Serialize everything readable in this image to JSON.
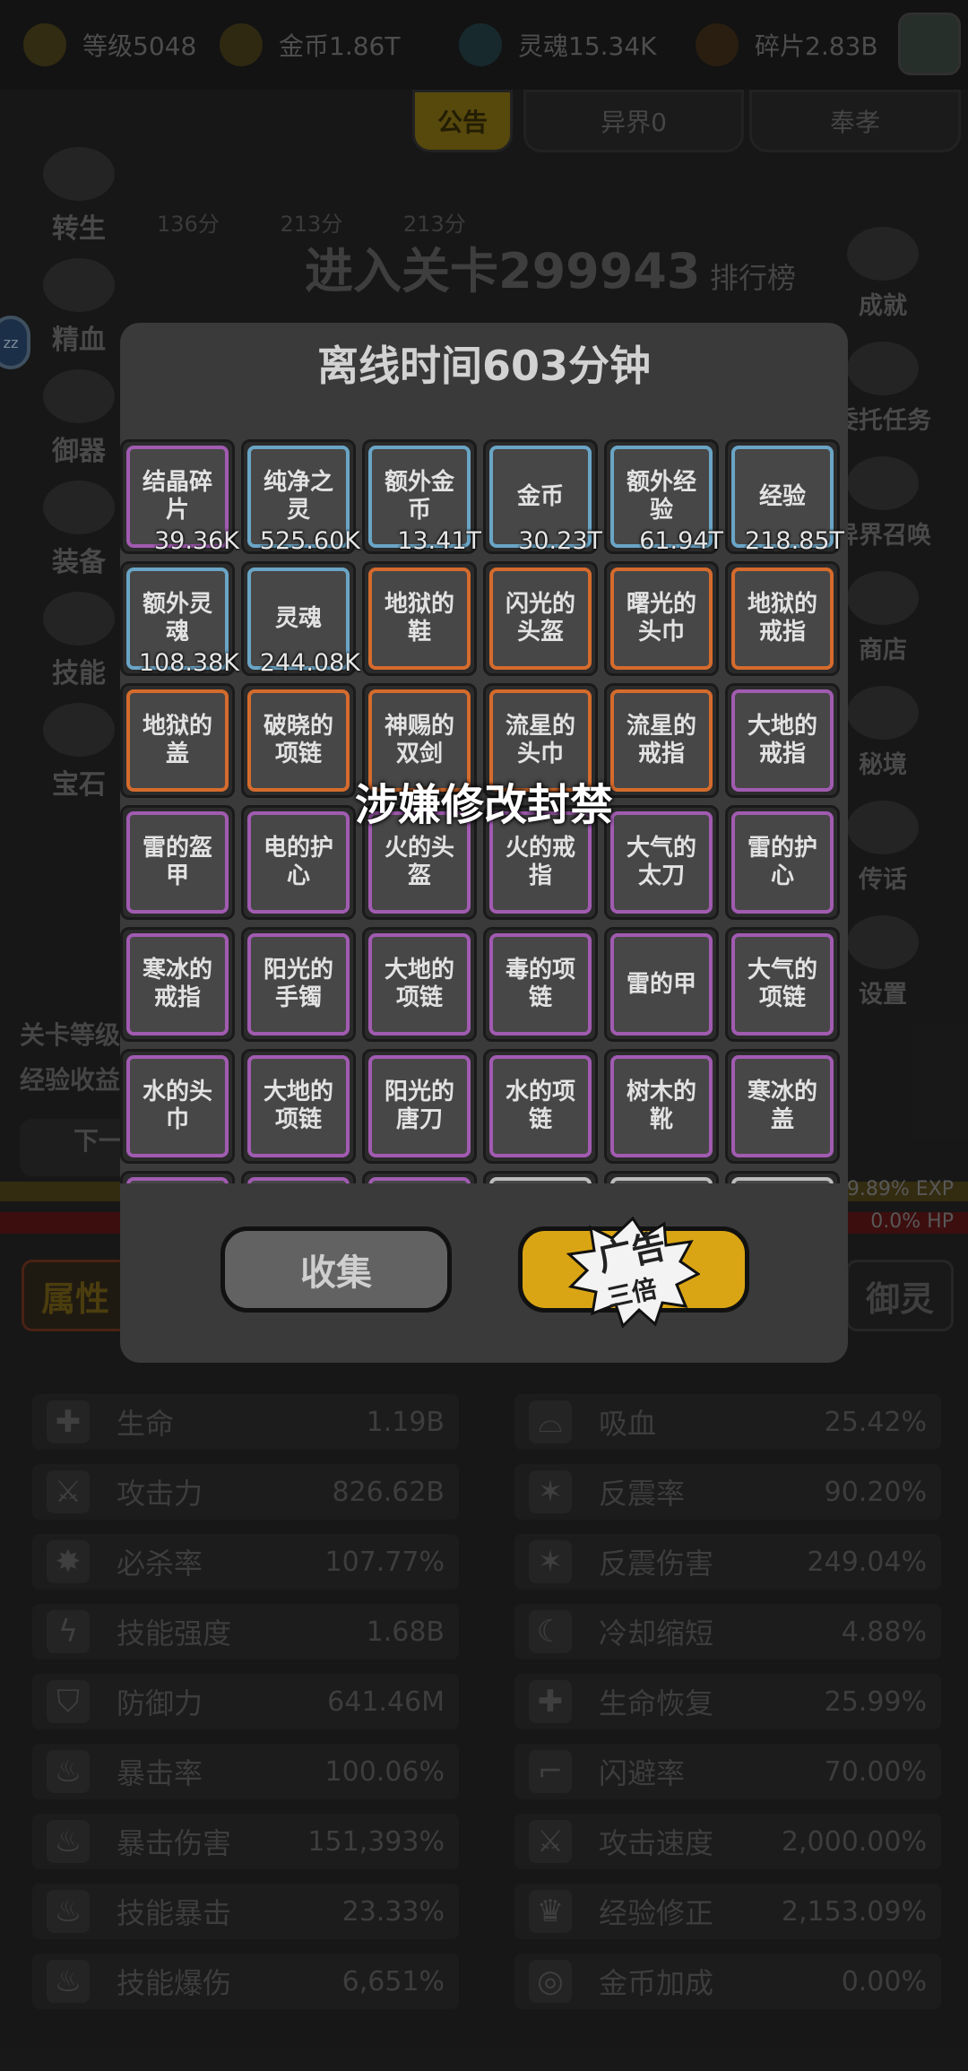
{
  "resources": [
    {
      "label": "等级5048",
      "icon": "crown-icon",
      "color": "#7a6a25"
    },
    {
      "label": "金币1.86T",
      "icon": "coin-icon",
      "color": "#6b5a20"
    },
    {
      "label": "灵魂15.34K",
      "icon": "soul-icon",
      "color": "#2d5560"
    },
    {
      "label": "碎片2.83B",
      "icon": "shard-icon",
      "color": "#5a4020"
    }
  ],
  "background": {
    "tabs": {
      "notice": "公告",
      "otherworld": "异界0",
      "offering": "奉孝"
    },
    "scores": [
      "136分",
      "213分",
      "213分"
    ],
    "stage_title": "进入关卡299943",
    "leaderboard": "排行榜",
    "zz_badge": "zz",
    "left_menu": [
      "转生",
      "精血",
      "御器",
      "装备",
      "技能",
      "宝石"
    ],
    "right_menu": [
      "成就",
      "委托任务",
      "异界召唤",
      "商店",
      "秘境",
      "传话",
      "设置"
    ],
    "stage_info": [
      "关卡等级",
      "经验收益"
    ],
    "next_button": "下一",
    "exp_text": "9.89% EXP",
    "hp_text": "0.0% HP",
    "bottom_tabs": {
      "left": "属性",
      "right": "御灵"
    }
  },
  "stats_left": [
    {
      "name": "生命",
      "value": "1.19B",
      "icon": "life-icon"
    },
    {
      "name": "攻击力",
      "value": "826.62B",
      "icon": "sword-icon"
    },
    {
      "name": "必杀率",
      "value": "107.77%",
      "icon": "crit-kill-icon"
    },
    {
      "name": "技能强度",
      "value": "1.68B",
      "icon": "lightning-icon"
    },
    {
      "name": "防御力",
      "value": "641.46M",
      "icon": "shield-icon"
    },
    {
      "name": "暴击率",
      "value": "100.06%",
      "icon": "flame-icon"
    },
    {
      "name": "暴击伤害",
      "value": "151,393%",
      "icon": "flame-icon"
    },
    {
      "name": "技能暴击",
      "value": "23.33%",
      "icon": "blue-flame-icon"
    },
    {
      "name": "技能爆伤",
      "value": "6,651%",
      "icon": "blue-flame-icon"
    }
  ],
  "stats_right": [
    {
      "name": "吸血",
      "value": "25.42%",
      "icon": "bat-icon"
    },
    {
      "name": "反震率",
      "value": "90.20%",
      "icon": "reflect-icon"
    },
    {
      "name": "反震伤害",
      "value": "249.04%",
      "icon": "reflect-icon"
    },
    {
      "name": "冷却缩短",
      "value": "4.88%",
      "icon": "moon-icon"
    },
    {
      "name": "生命恢复",
      "value": "25.99%",
      "icon": "heal-icon"
    },
    {
      "name": "闪避率",
      "value": "70.00%",
      "icon": "boot-icon"
    },
    {
      "name": "攻击速度",
      "value": "2,000.00%",
      "icon": "swords-icon"
    },
    {
      "name": "经验修正",
      "value": "2,153.09%",
      "icon": "crown-icon"
    },
    {
      "name": "金币加成",
      "value": "0.00%",
      "icon": "coin-icon"
    }
  ],
  "modal": {
    "title": "离线时间603分钟",
    "ban_text": "涉嫌修改封禁",
    "collect_button": "收集",
    "ad_button": "广告",
    "ad_sub": "三倍",
    "rarity_colors": {
      "blue": "#6aa5c6",
      "orange": "#d56b2c",
      "purple": "#a15bb1",
      "white": "#bcbcbc"
    },
    "items": [
      {
        "name": "结晶碎片",
        "count": "39.36K",
        "rarity": "purple"
      },
      {
        "name": "纯净之灵",
        "count": "525.60K",
        "rarity": "blue"
      },
      {
        "name": "额外金币",
        "count": "13.41T",
        "rarity": "blue"
      },
      {
        "name": "金币",
        "count": "30.23T",
        "rarity": "blue"
      },
      {
        "name": "额外经验",
        "count": "61.94T",
        "rarity": "blue"
      },
      {
        "name": "经验",
        "count": "218.85T",
        "rarity": "blue"
      },
      {
        "name": "额外灵魂",
        "count": "108.38K",
        "rarity": "blue"
      },
      {
        "name": "灵魂",
        "count": "244.08K",
        "rarity": "blue"
      },
      {
        "name": "地狱的鞋",
        "count": "",
        "rarity": "orange"
      },
      {
        "name": "闪光的头盔",
        "count": "",
        "rarity": "orange"
      },
      {
        "name": "曙光的头巾",
        "count": "",
        "rarity": "orange"
      },
      {
        "name": "地狱的戒指",
        "count": "",
        "rarity": "orange"
      },
      {
        "name": "地狱的盖",
        "count": "",
        "rarity": "orange"
      },
      {
        "name": "破晓的项链",
        "count": "",
        "rarity": "orange"
      },
      {
        "name": "神赐的双剑",
        "count": "",
        "rarity": "orange"
      },
      {
        "name": "流星的头巾",
        "count": "",
        "rarity": "orange"
      },
      {
        "name": "流星的戒指",
        "count": "",
        "rarity": "orange"
      },
      {
        "name": "大地的戒指",
        "count": "",
        "rarity": "purple"
      },
      {
        "name": "雷的盔甲",
        "count": "",
        "rarity": "purple"
      },
      {
        "name": "电的护心",
        "count": "",
        "rarity": "purple"
      },
      {
        "name": "火的头盔",
        "count": "",
        "rarity": "purple"
      },
      {
        "name": "火的戒指",
        "count": "",
        "rarity": "purple"
      },
      {
        "name": "大气的太刀",
        "count": "",
        "rarity": "purple"
      },
      {
        "name": "雷的护心",
        "count": "",
        "rarity": "purple"
      },
      {
        "name": "寒冰的戒指",
        "count": "",
        "rarity": "purple"
      },
      {
        "name": "阳光的手镯",
        "count": "",
        "rarity": "purple"
      },
      {
        "name": "大地的项链",
        "count": "",
        "rarity": "purple"
      },
      {
        "name": "毒的项链",
        "count": "",
        "rarity": "purple"
      },
      {
        "name": "雷的甲",
        "count": "",
        "rarity": "purple"
      },
      {
        "name": "大气的项链",
        "count": "",
        "rarity": "purple"
      },
      {
        "name": "水的头巾",
        "count": "",
        "rarity": "purple"
      },
      {
        "name": "大地的项链",
        "count": "",
        "rarity": "purple"
      },
      {
        "name": "阳光的唐刀",
        "count": "",
        "rarity": "purple"
      },
      {
        "name": "水的项链",
        "count": "",
        "rarity": "purple"
      },
      {
        "name": "树木的靴",
        "count": "",
        "rarity": "purple"
      },
      {
        "name": "寒冰的盖",
        "count": "",
        "rarity": "purple"
      },
      {
        "name": "",
        "count": "",
        "rarity": "purple"
      },
      {
        "name": "",
        "count": "",
        "rarity": "purple"
      },
      {
        "name": "",
        "count": "",
        "rarity": "purple"
      },
      {
        "name": "",
        "count": "",
        "rarity": "white"
      },
      {
        "name": "",
        "count": "",
        "rarity": "white"
      },
      {
        "name": "",
        "count": "",
        "rarity": "white"
      }
    ]
  }
}
